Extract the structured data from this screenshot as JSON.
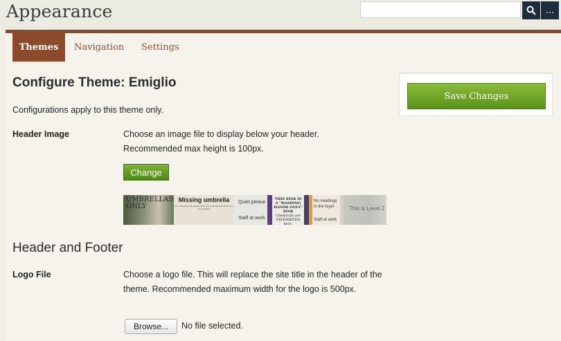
{
  "app": {
    "title": "Appearance"
  },
  "search": {
    "placeholder": "",
    "more_label": "..."
  },
  "tabs": [
    {
      "label": "Themes",
      "active": true
    },
    {
      "label": "Navigation",
      "active": false
    },
    {
      "label": "Settings",
      "active": false
    }
  ],
  "page": {
    "title": "Configure Theme: Emiglio",
    "note": "Configurations apply to this theme only."
  },
  "header_image": {
    "label": "Header Image",
    "desc_line1": "Choose an image file to display below your header.",
    "desc_line2": "Recommended max height is 100px.",
    "button": "Change",
    "banner_texts": {
      "umbrellas": "UMBRELLAS ONLY",
      "missing_title": "Missing umbrella",
      "missing_small": "The umbrella in the cupboard big blue umbrella with ASFM logo has vanished",
      "quiet": "Quiet please",
      "staff": "Staff at work",
      "sink": "THIS SINK IS A \"WASHING HANDS ONLY\" SINK",
      "chemicals": "Chemicals are PROHIBITED here.",
      "meetings": "No meetings in the foyer",
      "staff2": "Staff at work",
      "level": "This is Level 2"
    }
  },
  "header_footer": {
    "title": "Header and Footer",
    "logo_label": "Logo File",
    "logo_desc": "Choose a logo file. This will replace the site title in the header of the theme. Recommended maximum width for the logo is 500px.",
    "browse": "Browse...",
    "no_file": "No file selected."
  },
  "save": {
    "label": "Save Changes"
  },
  "colors": {
    "accent_brown": "#8b4a2b",
    "save_green": "#6da227",
    "search_dark": "#1e2d3b"
  }
}
